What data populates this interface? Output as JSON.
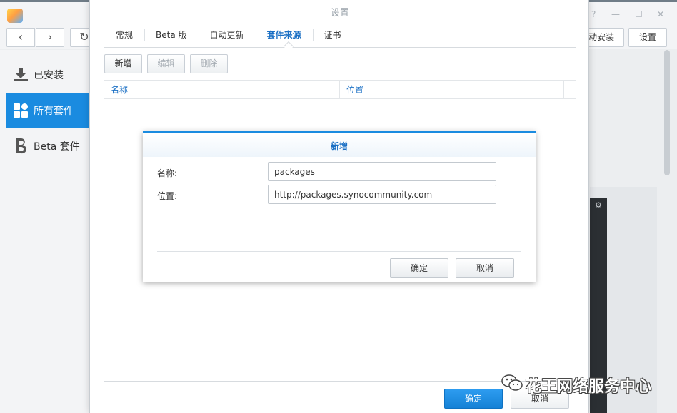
{
  "window": {
    "help_glyph": "?",
    "minimize_glyph": "—",
    "maximize_glyph": "☐",
    "close_glyph": "✕"
  },
  "toolbar": {
    "back_glyph": "‹",
    "forward_glyph": "›",
    "refresh_glyph": "↻",
    "auto_install_label": "动安装",
    "settings_label": "设置"
  },
  "sidebar": {
    "items": [
      {
        "label": "已安装",
        "icon": "download-icon",
        "active": false
      },
      {
        "label": "所有套件",
        "icon": "grid-icon",
        "active": true
      },
      {
        "label": "Beta 套件",
        "icon": "beta-icon",
        "active": false
      }
    ]
  },
  "background": {
    "gear_glyph": "⚙"
  },
  "settings": {
    "title": "设置",
    "tabs": [
      {
        "label": "常规",
        "active": false
      },
      {
        "label": "Beta 版",
        "active": false
      },
      {
        "label": "自动更新",
        "active": false
      },
      {
        "label": "套件来源",
        "active": true
      },
      {
        "label": "证书",
        "active": false
      }
    ],
    "actions": {
      "add": "新增",
      "edit": "编辑",
      "delete": "删除"
    },
    "columns": {
      "name": "名称",
      "location": "位置"
    },
    "footer": {
      "ok": "确定",
      "cancel": "取消"
    }
  },
  "modal": {
    "title": "新增",
    "name_label": "名称:",
    "name_value": "packages",
    "location_label": "位置:",
    "location_value": "http://packages.synocommunity.com",
    "ok": "确定",
    "cancel": "取消"
  },
  "watermark": {
    "text": "花王网络服务中心",
    "icon": "wechat-icon"
  },
  "colors": {
    "accent": "#1a8be0",
    "link_blue": "#1a6fc4",
    "disabled_text": "#a5acb3"
  }
}
